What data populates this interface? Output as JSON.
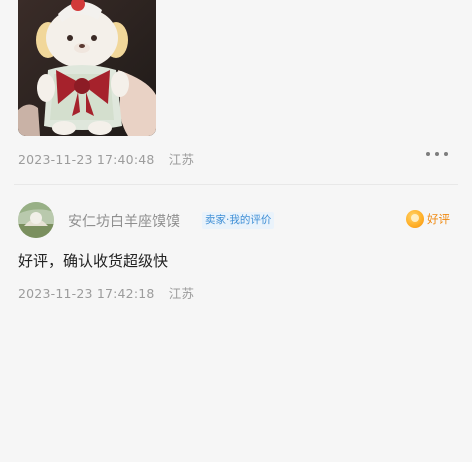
{
  "prev_review": {
    "date": "2023-11-23 17:40:48",
    "location": "江苏"
  },
  "review": {
    "username": "安仁坊白羊座馍馍",
    "seller_tag": "卖家·我的评价",
    "rating_label": "好评",
    "text": "好评，确认收货超级快",
    "date": "2023-11-23 17:42:18",
    "location": "江苏"
  },
  "icons": {
    "more": "more-dots-icon",
    "rating": "good-rating-badge-icon"
  },
  "colors": {
    "seller_tag_text": "#3f8fd6",
    "rating_orange": "#f08a12",
    "meta_gray": "#9c9c9c"
  }
}
